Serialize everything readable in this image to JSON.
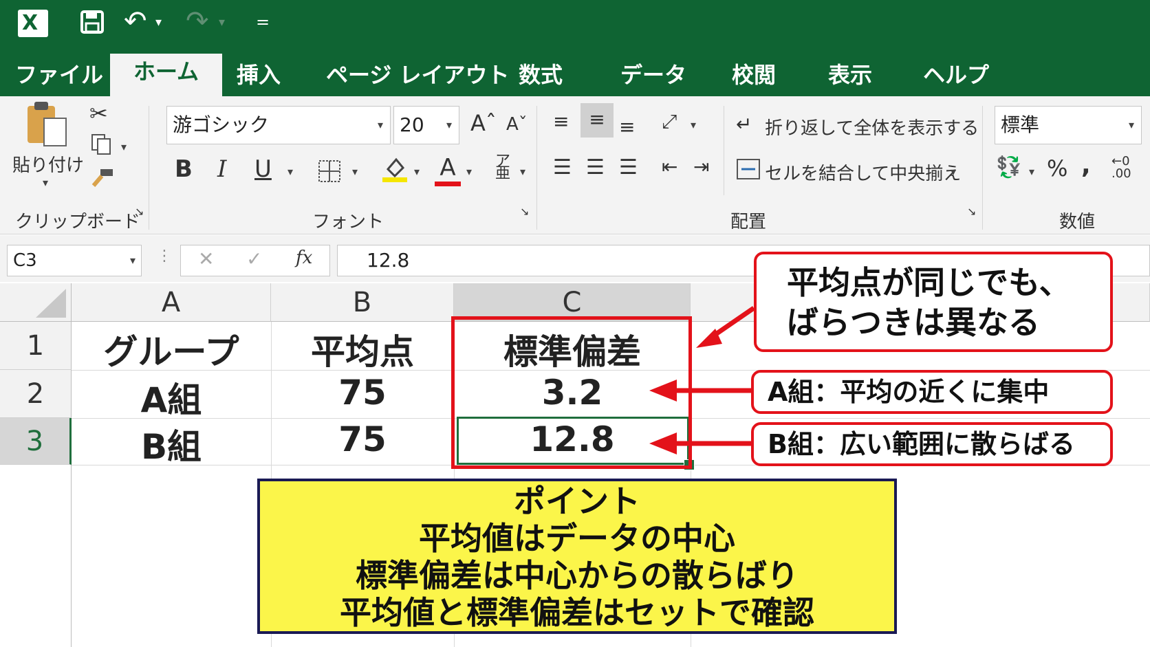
{
  "quick_access": {
    "excel_logo": "X",
    "undo": "↶",
    "redo": "↷",
    "customize": "="
  },
  "tabs": [
    "ファイル",
    "ホーム",
    "挿入",
    "ページ レイアウト",
    "数式",
    "データ",
    "校閲",
    "表示",
    "ヘルプ"
  ],
  "ribbon": {
    "clipboard": {
      "paste_label": "貼り付け",
      "group_label": "クリップボード"
    },
    "font": {
      "font_name": "游ゴシック",
      "font_size": "20",
      "group_label": "フォント",
      "bold": "B",
      "italic": "I",
      "underline": "U",
      "font_color_letter": "A"
    },
    "alignment": {
      "wrap_text": "折り返して全体を表示する",
      "merge_center": "セルを結合して中央揃え",
      "group_label": "配置"
    },
    "number": {
      "format": "標準",
      "percent": "%",
      "comma": ",",
      "group_label": "数値"
    }
  },
  "formula_bar": {
    "name_box": "C3",
    "fx": "fx",
    "value": "12.8"
  },
  "columns": [
    "A",
    "B",
    "C"
  ],
  "rows": [
    "1",
    "2",
    "3"
  ],
  "table": {
    "headers": [
      "グループ",
      "平均点",
      "標準偏差"
    ],
    "data": [
      [
        "A組",
        "75",
        "3.2"
      ],
      [
        "B組",
        "75",
        "12.8"
      ]
    ]
  },
  "annotations": {
    "main_callout": [
      "平均点が同じでも、",
      "ばらつきは異なる"
    ],
    "a_note": "A組：平均の近くに集中",
    "b_note": "B組：広い範囲に散らばる",
    "point_lines": [
      "ポイント",
      "平均値はデータの中心",
      "標準偏差は中心からの散らばり",
      "平均値と標準偏差はセットで確認"
    ]
  },
  "colors": {
    "excel_green": "#0f6433",
    "highlight_red": "#e3121a",
    "point_yellow": "#fbf54a",
    "point_border": "#1a1a55"
  }
}
